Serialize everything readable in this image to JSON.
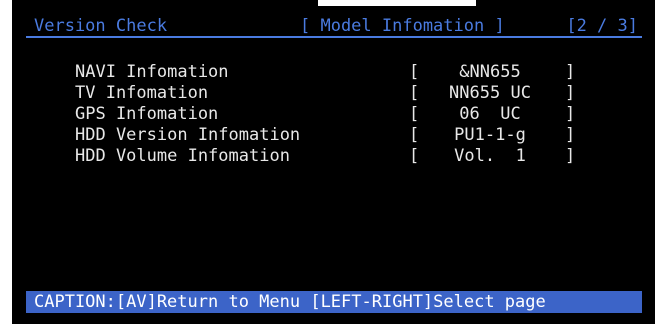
{
  "header": {
    "title": "Version Check",
    "section": "[ Model Infomation ]",
    "page": "[2 / 3]"
  },
  "info": [
    {
      "label": "NAVI Infomation",
      "open": "[",
      "value": "&NN655",
      "close": "]"
    },
    {
      "label": "TV Infomation",
      "open": "[",
      "value": "NN655 UC",
      "close": "]"
    },
    {
      "label": "GPS Infomation",
      "open": "[",
      "value": "06  UC",
      "close": "]"
    },
    {
      "label": "HDD Version Infomation",
      "open": "[",
      "value": "PU1-1-g",
      "close": "]"
    },
    {
      "label": "HDD Volume Infomation",
      "open": "[",
      "value": "Vol.  1",
      "close": "]"
    }
  ],
  "caption": "CAPTION:[AV]Return to Menu [LEFT-RIGHT]Select page",
  "colors": {
    "background": "#000000",
    "header": "#4a7be0",
    "text": "#e8e8e8",
    "caption_bar": "#3c64c8"
  }
}
